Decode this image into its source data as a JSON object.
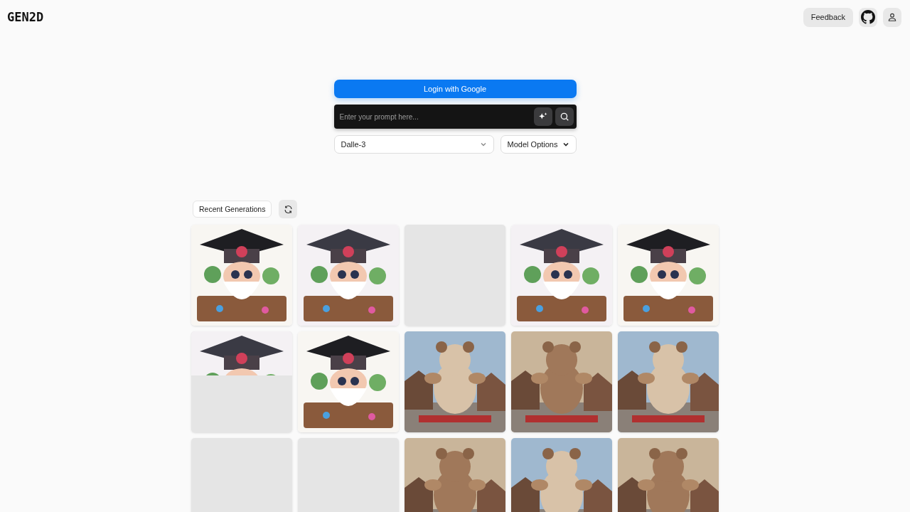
{
  "header": {
    "logo": "GEN2D",
    "feedback_button": "Feedback"
  },
  "login_button": "Login with Google",
  "prompt": {
    "placeholder": "Enter your prompt here..."
  },
  "model_select": {
    "value": "Dalle-3"
  },
  "model_options_button": "Model Options",
  "gallery": {
    "title": "Recent Generations",
    "tiles": [
      {
        "kind": "picture"
      },
      {
        "kind": "picture"
      },
      {
        "kind": "empty"
      },
      {
        "kind": "picture"
      },
      {
        "kind": "picture"
      },
      {
        "kind": "partial"
      },
      {
        "kind": "picture"
      },
      {
        "kind": "picture"
      },
      {
        "kind": "picture"
      },
      {
        "kind": "picture"
      },
      {
        "kind": "empty"
      },
      {
        "kind": "empty"
      },
      {
        "kind": "picture"
      },
      {
        "kind": "picture"
      },
      {
        "kind": "picture"
      }
    ]
  }
}
